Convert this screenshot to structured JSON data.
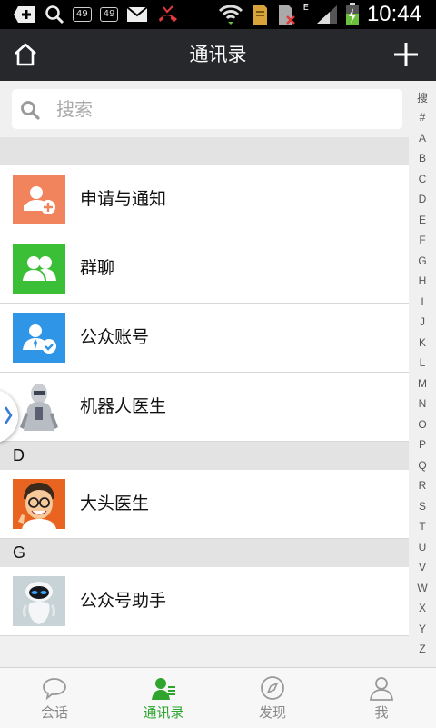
{
  "status_bar": {
    "box_a": "49",
    "box_b": "49",
    "network": "E",
    "time": "10:44"
  },
  "app_bar": {
    "title": "通讯录",
    "home_icon": "home-icon",
    "add_icon": "plus-icon"
  },
  "search": {
    "placeholder": "搜索"
  },
  "rows_top": [
    {
      "label": "申请与通知",
      "icon": "person-add-icon",
      "color": "#f2845d"
    },
    {
      "label": "群聊",
      "icon": "group-icon",
      "color": "#3bbf37"
    },
    {
      "label": "公众账号",
      "icon": "person-verified-icon",
      "color": "#2f95e6"
    },
    {
      "label": "机器人医生",
      "icon": "robot-avatar"
    }
  ],
  "sections": [
    {
      "header": "D",
      "rows": [
        {
          "label": "大头医生",
          "icon": "doctor-avatar"
        }
      ]
    },
    {
      "header": "G",
      "rows": [
        {
          "label": "公众号助手",
          "icon": "eve-robot-avatar"
        }
      ]
    }
  ],
  "index_letters": [
    "搜",
    "#",
    "A",
    "B",
    "C",
    "D",
    "E",
    "F",
    "G",
    "H",
    "I",
    "J",
    "K",
    "L",
    "M",
    "N",
    "O",
    "P",
    "Q",
    "R",
    "S",
    "T",
    "U",
    "V",
    "W",
    "X",
    "Y",
    "Z"
  ],
  "tabs": [
    {
      "label": "会话",
      "icon": "chat-bubble-icon",
      "active": false
    },
    {
      "label": "通讯录",
      "icon": "contacts-icon",
      "active": true
    },
    {
      "label": "发现",
      "icon": "compass-icon",
      "active": false
    },
    {
      "label": "我",
      "icon": "person-icon",
      "active": false
    }
  ],
  "colors": {
    "accent": "#2fa52f",
    "appbar": "#27282b"
  }
}
